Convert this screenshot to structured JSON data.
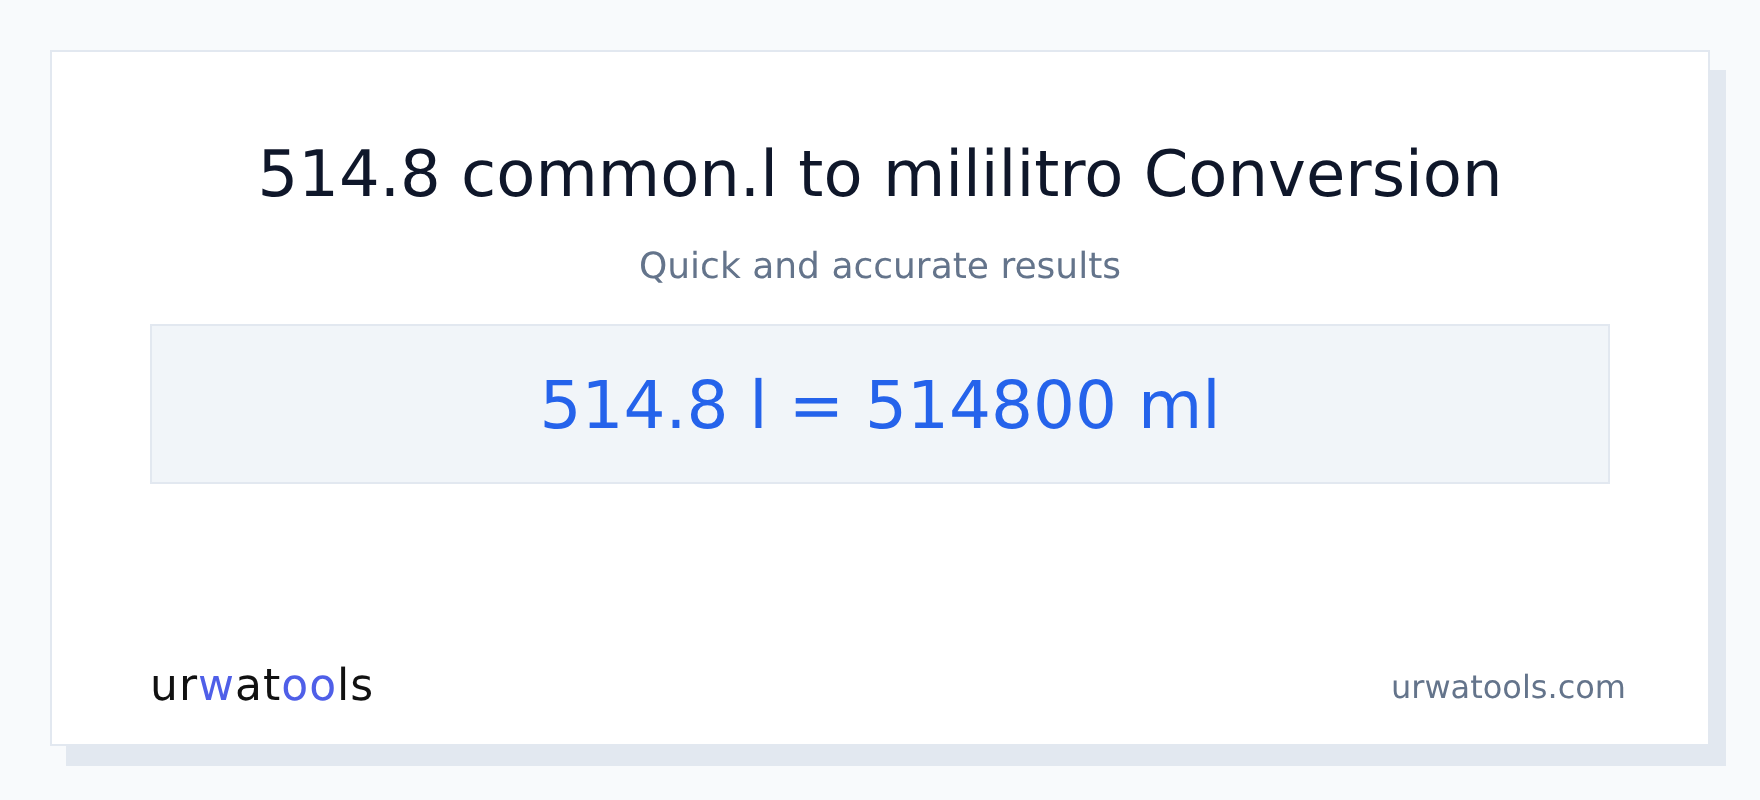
{
  "title": "514.8 common.l to mililitro Conversion",
  "subtitle": "Quick and accurate results",
  "result": "514.8 l = 514800 ml",
  "logo": [
    {
      "text": "ur",
      "accent": false
    },
    {
      "text": "w",
      "accent": true
    },
    {
      "text": "at",
      "accent": false
    },
    {
      "text": "oo",
      "accent": true
    },
    {
      "text": "ls",
      "accent": false
    }
  ],
  "site": "urwatools.com"
}
